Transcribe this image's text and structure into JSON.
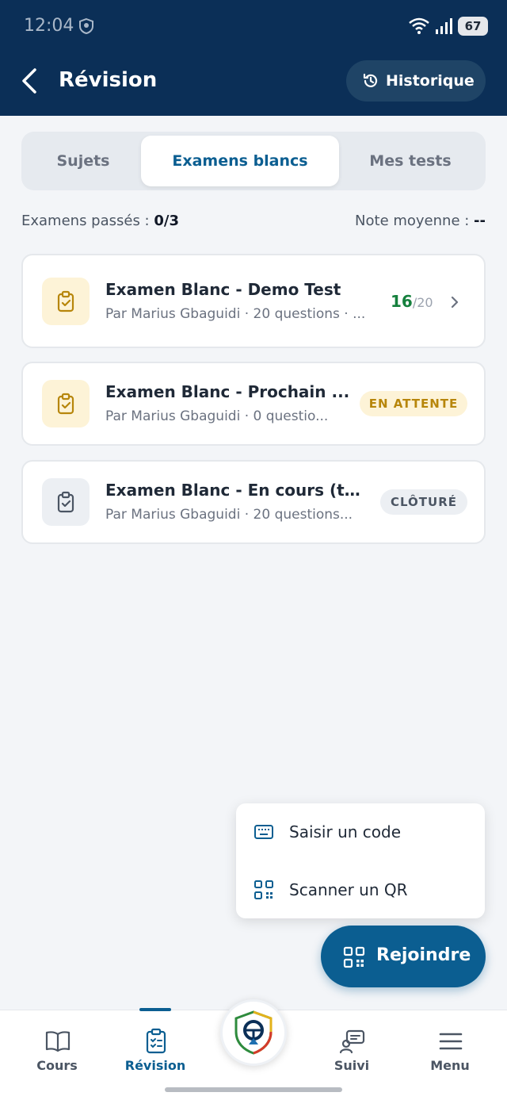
{
  "status_bar": {
    "time": "12:04",
    "battery": "67"
  },
  "header": {
    "title": "Révision",
    "history_label": "Historique"
  },
  "tabs": [
    {
      "label": "Sujets",
      "active": false
    },
    {
      "label": "Examens blancs",
      "active": true
    },
    {
      "label": "Mes tests",
      "active": false
    }
  ],
  "stats": {
    "passed_label": "Examens passés : ",
    "passed_value": "0/3",
    "average_label": "Note moyenne : ",
    "average_value": "--"
  },
  "exams": [
    {
      "title": "Examen Blanc - Demo Test",
      "subtitle": "Par Marius Gbaguidi · 20 questions · ...",
      "score": "16",
      "score_denominator": "/20"
    },
    {
      "title": "Examen Blanc - Prochain ...",
      "subtitle": "Par Marius Gbaguidi · 0 questio...",
      "badge": "EN ATTENTE"
    },
    {
      "title": "Examen Blanc - En cours (te...",
      "subtitle": "Par Marius Gbaguidi · 20 questions...",
      "badge": "CLÔTURÉ"
    }
  ],
  "join_menu": {
    "enter_code_label": "Saisir un code",
    "scan_qr_label": "Scanner un QR"
  },
  "fab": {
    "label": "Rejoindre"
  },
  "bottom_nav": [
    {
      "label": "Cours",
      "icon": "book-icon"
    },
    {
      "label": "Révision",
      "icon": "clipboard-icon",
      "active": true
    },
    {
      "label": "",
      "icon": "app-logo-icon"
    },
    {
      "label": "Suivi",
      "icon": "chat-user-icon"
    },
    {
      "label": "Menu",
      "icon": "menu-icon"
    }
  ],
  "colors": {
    "header_bg": "#0b2f57",
    "primary": "#0b5e91",
    "score_green": "#15803d",
    "pending_badge_bg": "#fdf3d7",
    "pending_badge_text": "#b7860b",
    "closed_badge_bg": "#eceff3"
  }
}
